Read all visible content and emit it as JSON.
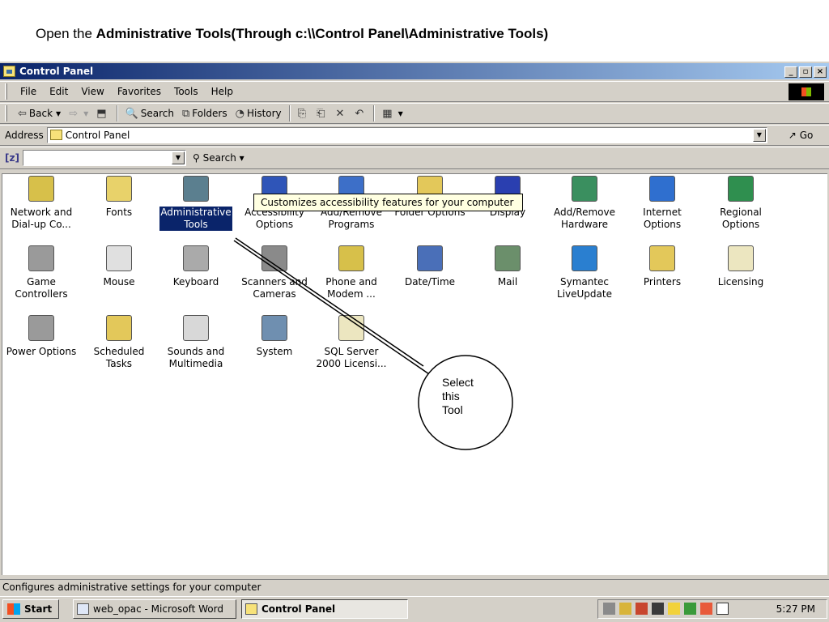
{
  "instruction": {
    "prefix": "Open the ",
    "bold": "Administrative Tools(Through c:\\\\Control Panel\\Administrative Tools)"
  },
  "window": {
    "title": "Control Panel",
    "controls": [
      "_",
      "▫",
      "×"
    ]
  },
  "menu": [
    "File",
    "Edit",
    "View",
    "Favorites",
    "Tools",
    "Help"
  ],
  "toolbar": {
    "back": "Back",
    "search": "Search",
    "folders": "Folders",
    "history": "History"
  },
  "address": {
    "label": "Address",
    "value": "Control Panel",
    "go": "Go"
  },
  "searchbar": {
    "icon": "[z]",
    "search": "Search"
  },
  "items": [
    {
      "label": "Network and\nDial-up Co...",
      "icon": "network-icon"
    },
    {
      "label": "Fonts",
      "icon": "fonts-icon"
    },
    {
      "label": "Administrative\nTools",
      "icon": "admin-tools-icon",
      "selected": true
    },
    {
      "label": "Accessibility\nOptions",
      "icon": "accessibility-icon"
    },
    {
      "label": "Add/Remove\nPrograms",
      "icon": "add-remove-programs-icon"
    },
    {
      "label": "Folder Options",
      "icon": "folder-options-icon"
    },
    {
      "label": "Display",
      "icon": "display-icon"
    },
    {
      "label": "Add/Remove\nHardware",
      "icon": "add-remove-hardware-icon"
    },
    {
      "label": "Internet\nOptions",
      "icon": "internet-options-icon"
    },
    {
      "label": "Regional\nOptions",
      "icon": "regional-options-icon"
    },
    {
      "label": "Game\nControllers",
      "icon": "game-controllers-icon"
    },
    {
      "label": "Mouse",
      "icon": "mouse-icon"
    },
    {
      "label": "Keyboard",
      "icon": "keyboard-icon"
    },
    {
      "label": "Scanners and\nCameras",
      "icon": "scanners-icon"
    },
    {
      "label": "Phone and\nModem ...",
      "icon": "phone-modem-icon"
    },
    {
      "label": "Date/Time",
      "icon": "date-time-icon"
    },
    {
      "label": "Mail",
      "icon": "mail-icon"
    },
    {
      "label": "Symantec\nLiveUpdate",
      "icon": "liveupdate-icon"
    },
    {
      "label": "Printers",
      "icon": "printers-icon"
    },
    {
      "label": "Licensing",
      "icon": "licensing-icon"
    },
    {
      "label": "Power Options",
      "icon": "power-options-icon"
    },
    {
      "label": "Scheduled\nTasks",
      "icon": "scheduled-tasks-icon"
    },
    {
      "label": "Sounds and\nMultimedia",
      "icon": "sounds-icon"
    },
    {
      "label": "System",
      "icon": "system-icon"
    },
    {
      "label": "SQL Server\n2000 Licensi...",
      "icon": "sql-licensing-icon"
    }
  ],
  "tooltip": "Customizes accessibility features for your computer",
  "status": "Configures administrative settings for your computer",
  "taskbar": {
    "start": "Start",
    "tasks": [
      "web_opac - Microsoft Word",
      "Control Panel"
    ],
    "clock": "5:27 PM"
  },
  "callout": "Select\nthis\nTool"
}
